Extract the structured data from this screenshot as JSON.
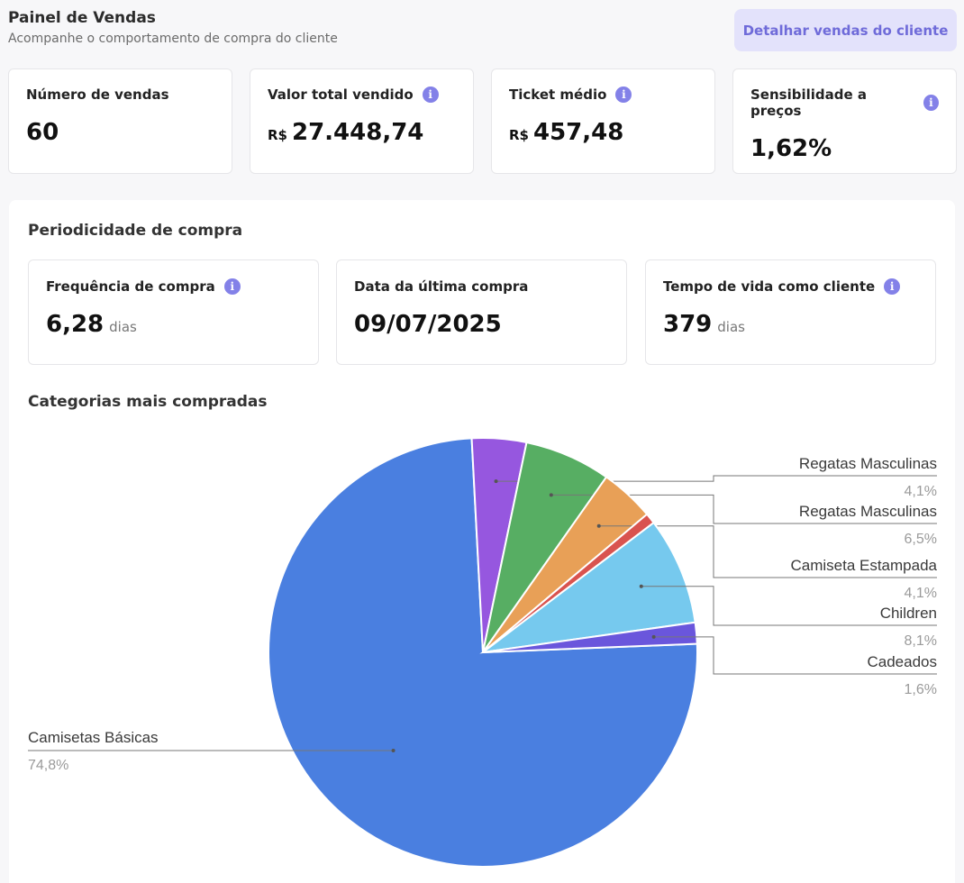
{
  "header": {
    "title": "Painel de Vendas",
    "subtitle": "Acompanhe o comportamento de compra do cliente",
    "detail_button": "Detalhar vendas do cliente"
  },
  "kpis": [
    {
      "label": "Número de vendas",
      "currency": "",
      "value": "60",
      "info": false
    },
    {
      "label": "Valor total vendido",
      "currency": "R$",
      "value": "27.448,74",
      "info": true
    },
    {
      "label": "Ticket médio",
      "currency": "R$",
      "value": "457,48",
      "info": true
    },
    {
      "label": "Sensibilidade a preços",
      "currency": "",
      "value": "1,62%",
      "info": true
    }
  ],
  "periodicity": {
    "title": "Periodicidade de compra",
    "cards": [
      {
        "label": "Frequência de compra",
        "value": "6,28",
        "unit": "dias",
        "info": true
      },
      {
        "label": "Data da última compra",
        "value": "09/07/2025",
        "unit": "",
        "info": false
      },
      {
        "label": "Tempo de vida como cliente",
        "value": "379",
        "unit": "dias",
        "info": true
      }
    ]
  },
  "categories": {
    "title": "Categorias mais compradas"
  },
  "info_glyph": "i",
  "chart_data": {
    "type": "pie",
    "title": "Categorias mais compradas",
    "slices": [
      {
        "label": "Camisetas Básicas",
        "value": 74.8,
        "display": "74,8%",
        "color": "#4a7fe0"
      },
      {
        "label": "Regatas Masculinas",
        "value": 4.1,
        "display": "4,1%",
        "color": "#9657df"
      },
      {
        "label": "Regatas Masculinas",
        "value": 6.5,
        "display": "6,5%",
        "color": "#57ae63"
      },
      {
        "label": "Camiseta Estampada",
        "value": 4.1,
        "display": "4,1%",
        "color": "#e8a057"
      },
      {
        "label": "",
        "value": 0.8,
        "display": "",
        "color": "#d9534f"
      },
      {
        "label": "Children",
        "value": 8.1,
        "display": "8,1%",
        "color": "#76c9ee"
      },
      {
        "label": "Cadeados",
        "value": 1.6,
        "display": "1,6%",
        "color": "#6a56dc"
      }
    ]
  }
}
